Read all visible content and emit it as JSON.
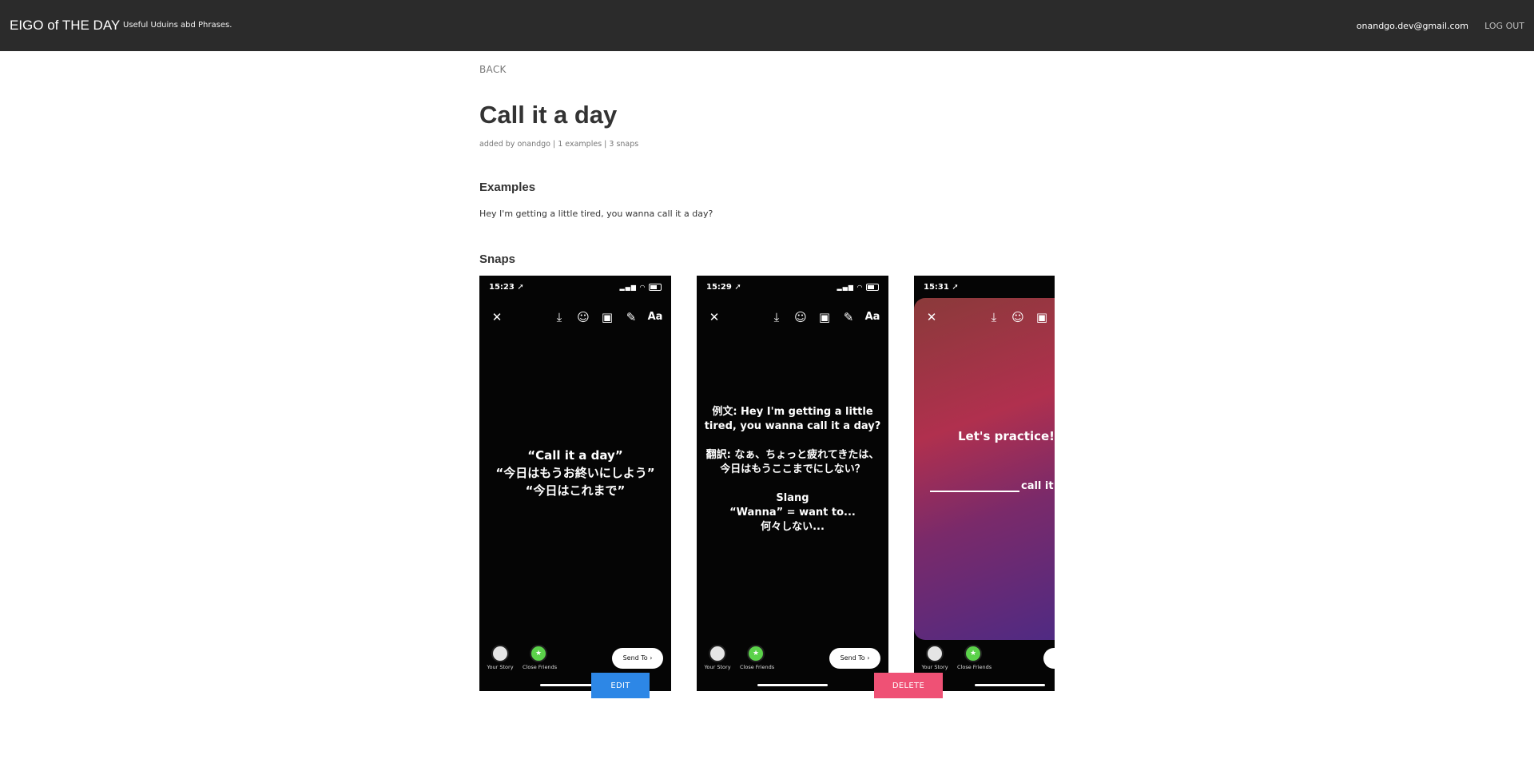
{
  "header": {
    "brand": "EIGO of THE DAY",
    "tagline": "Useful Uduins abd Phrases.",
    "user_email": "onandgo.dev@gmail.com",
    "logout_label": "LOG OUT"
  },
  "page": {
    "back_label": "BACK",
    "title": "Call it a day",
    "meta": "added by onandgo | 1 examples | 3 snaps",
    "examples_heading": "Examples",
    "examples": [
      "Hey I'm getting a little tired, you wanna call it a day?"
    ],
    "snaps_heading": "Snaps"
  },
  "snaps": [
    {
      "time": "15:23",
      "text": "“Call it a day”\n“今日はもうお終いにしよう”\n“今日はこれまで”",
      "story_label": "Your Story",
      "close_friends_label": "Close Friends",
      "send_label": "Send To"
    },
    {
      "time": "15:29",
      "text": "例文: Hey I'm getting a little\ntired, you wanna call it a day?\n\n翻訳: なぁ、ちょっと疲れてきたは、\n今日はもうここまでにしない？\n\nSlang\n“Wanna” = want to...\n何々しない...",
      "story_label": "Your Story",
      "close_friends_label": "Close Friends",
      "send_label": "Send To"
    },
    {
      "time": "15:31",
      "text_line1": "Let's practice!",
      "text_line2": "call it",
      "story_label": "Your Story",
      "close_friends_label": "Close Friends"
    }
  ],
  "actions": {
    "edit_label": "EDIT",
    "delete_label": "DELETE"
  },
  "colors": {
    "topbar": "#2b2b2b",
    "edit_button": "#2d87e6",
    "delete_button": "#ef5175"
  },
  "icons": [
    "close-icon",
    "download-icon",
    "face-effects-icon",
    "sticker-icon",
    "draw-icon",
    "text-icon",
    "location-arrow-icon",
    "signal-icon",
    "wifi-icon",
    "battery-icon",
    "chevron-right-icon",
    "star-icon"
  ]
}
